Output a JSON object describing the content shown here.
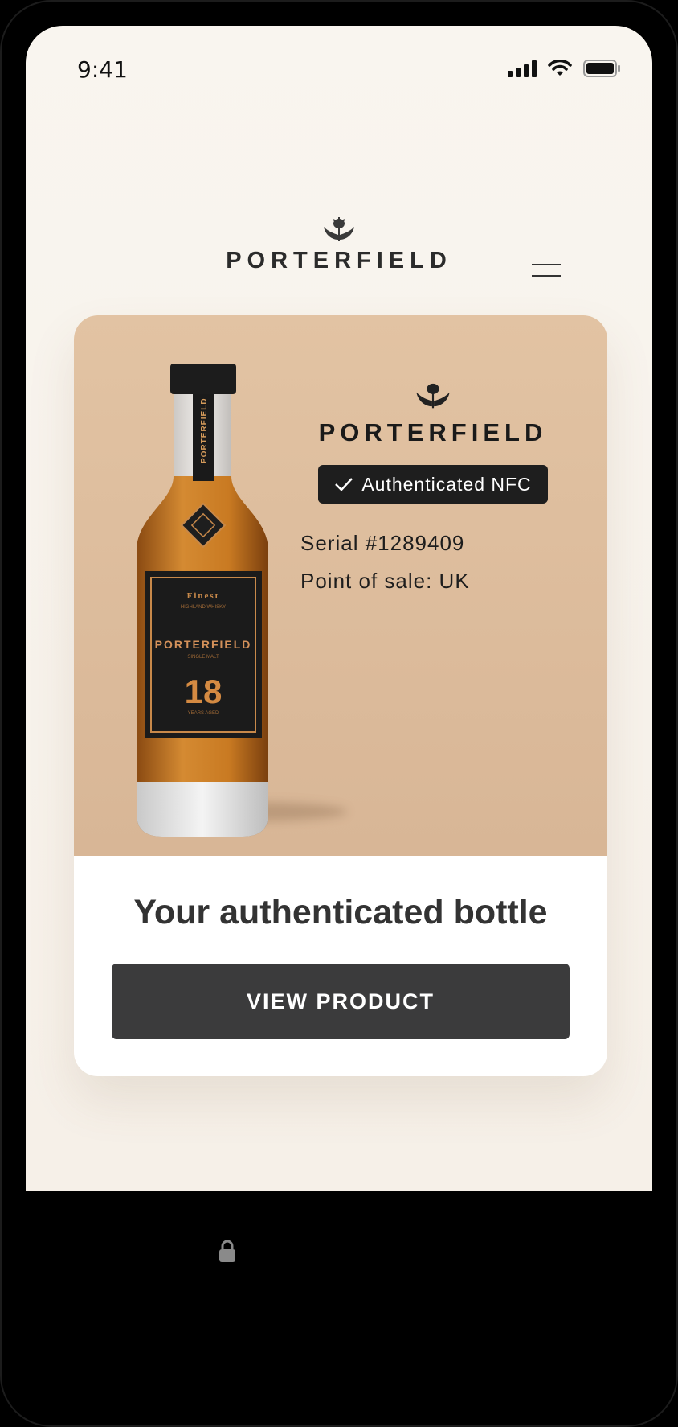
{
  "status_bar": {
    "time": "9:41"
  },
  "header": {
    "brand": "PORTERFIELD",
    "logo_icon": "thistle-icon",
    "menu_icon": "hamburger-menu-icon"
  },
  "card": {
    "brand": "PORTERFIELD",
    "badge": {
      "icon": "checkmark-icon",
      "label": "Authenticated NFC"
    },
    "serial": "Serial #1289409",
    "point_of_sale": "Point of sale: UK",
    "title": "Your authenticated bottle",
    "cta_label": "VIEW PRODUCT"
  },
  "bottle_label": {
    "neck_text": "PORTERFIELD",
    "line1": "Finest",
    "line2": "HIGHLAND WHISKY",
    "brand": "PORTERFIELD",
    "type": "SINGLE MALT",
    "age": "18",
    "age_caption": "YEARS AGED"
  },
  "colors": {
    "hero_bg": "#dfbf9e",
    "button": "#3b3b3c",
    "page_bg": "#f8f3ec",
    "label_gold": "#c8894a"
  },
  "lock_screen_icon": "lock-icon"
}
